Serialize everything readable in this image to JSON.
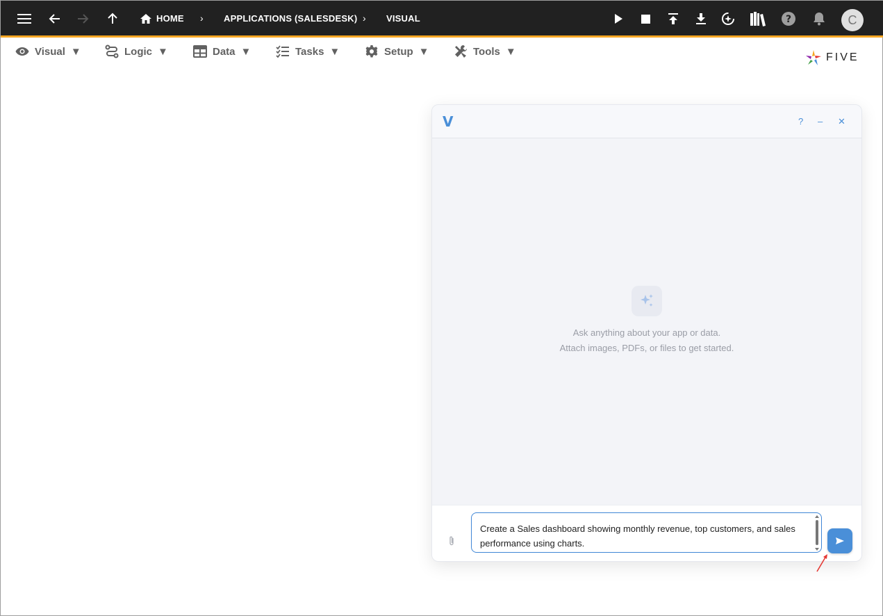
{
  "topbar": {
    "breadcrumbs": [
      "HOME",
      "APPLICATIONS (SALESDESK)",
      "VISUAL"
    ],
    "avatar_initial": "C"
  },
  "menu": {
    "items": [
      {
        "label": "Visual",
        "icon": "eye-icon"
      },
      {
        "label": "Logic",
        "icon": "logic-icon"
      },
      {
        "label": "Data",
        "icon": "table-icon"
      },
      {
        "label": "Tasks",
        "icon": "checklist-icon"
      },
      {
        "label": "Setup",
        "icon": "gear-icon"
      },
      {
        "label": "Tools",
        "icon": "tools-icon"
      }
    ],
    "arrow": "▼"
  },
  "logo": {
    "text": "FIVE"
  },
  "chat": {
    "brand": "V",
    "help_label": "?",
    "minimize_label": "–",
    "close_label": "✕",
    "empty_line1": "Ask anything about your app or data.",
    "empty_line2": "Attach images, PDFs, or files to get started.",
    "input_value": "Create a Sales dashboard showing monthly revenue, top customers, and sales performance using charts."
  },
  "colors": {
    "topbar": "#212121",
    "accent": "#f5a623",
    "chat_accent": "#4a8fd8"
  }
}
